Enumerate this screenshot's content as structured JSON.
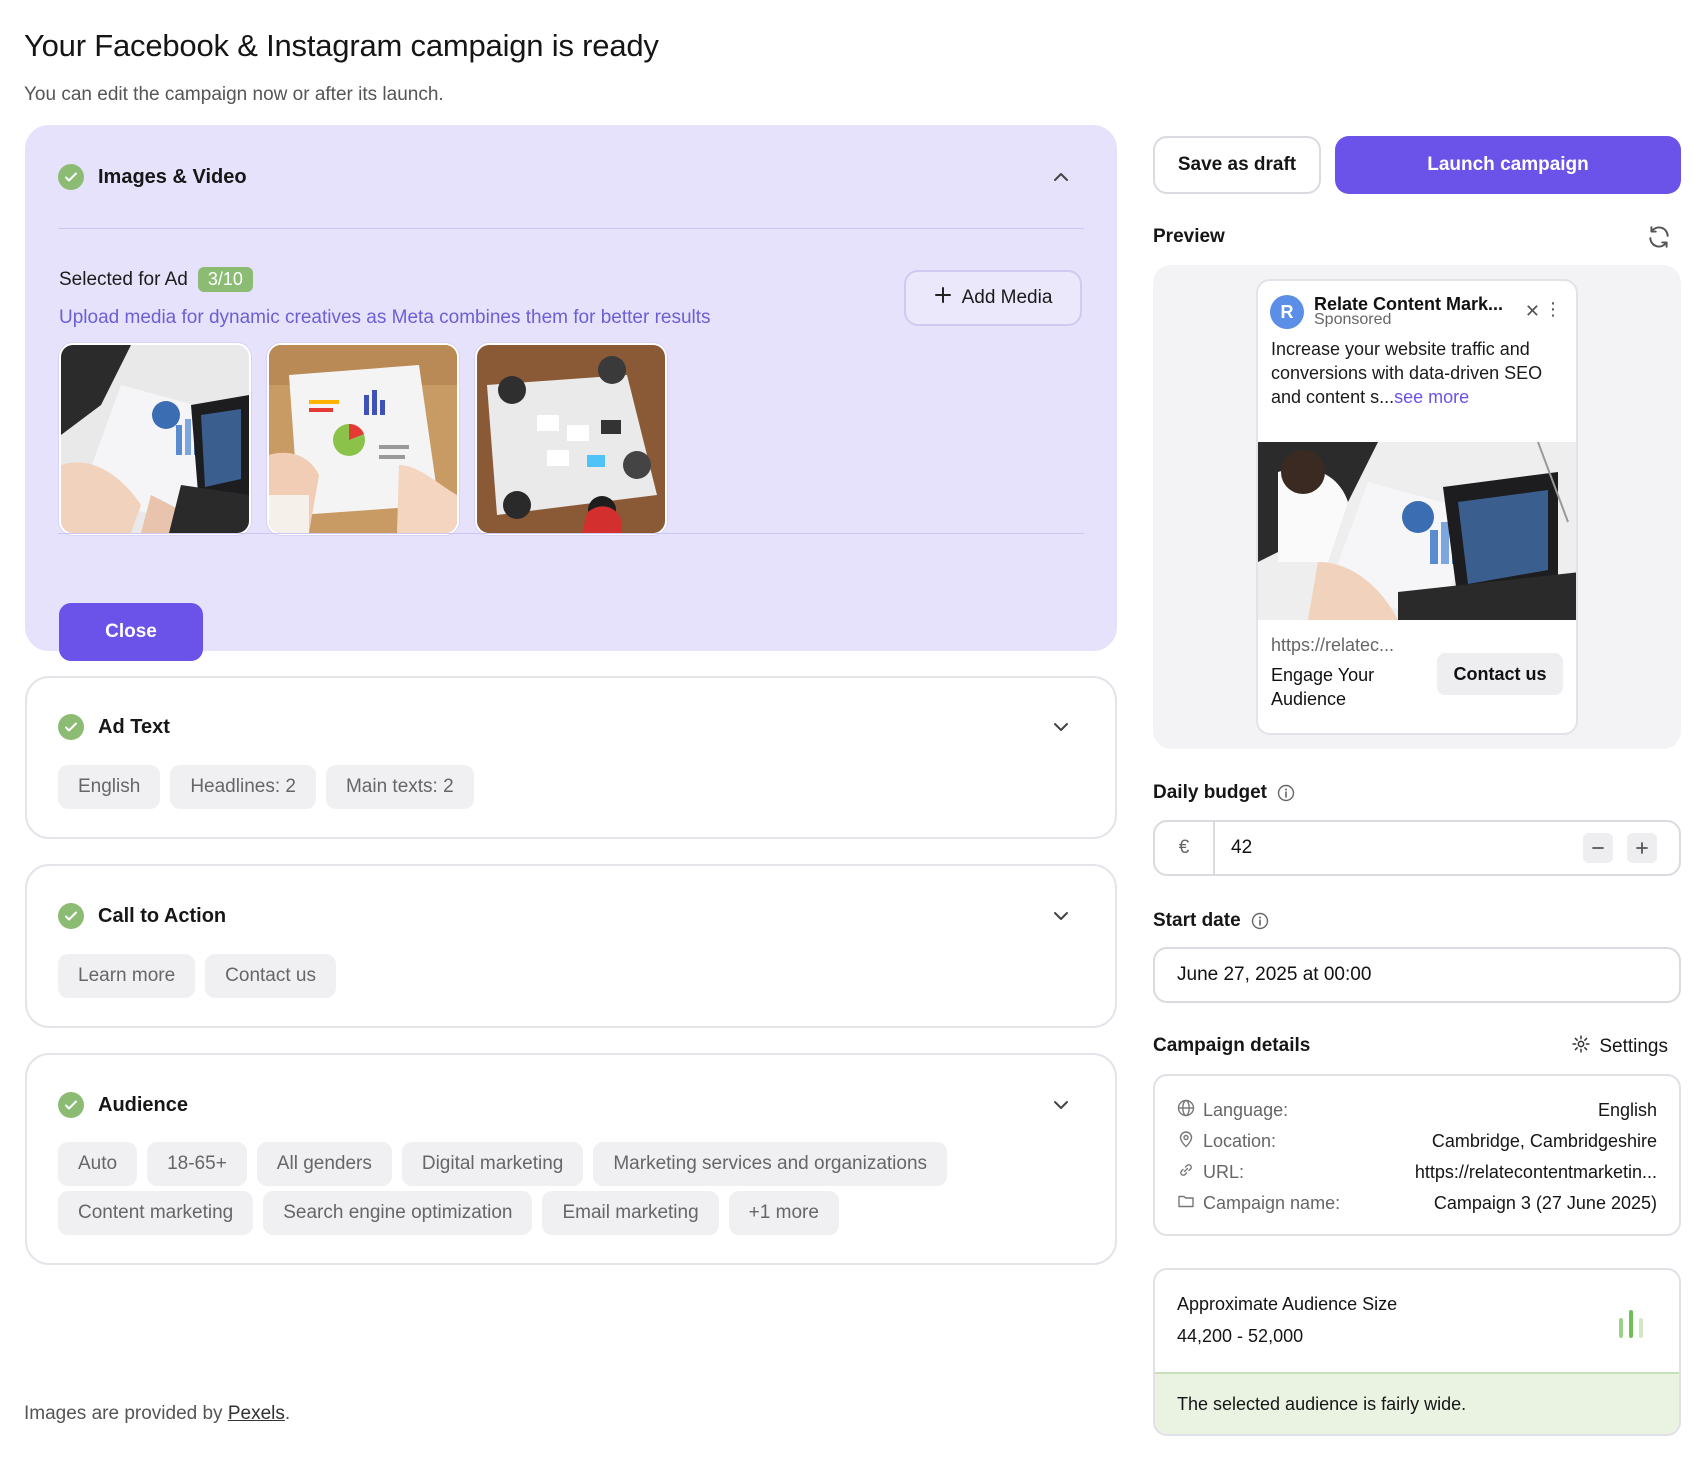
{
  "page": {
    "title": "Your Facebook & Instagram campaign is ready",
    "subtitle": "You can edit the campaign now or after its launch."
  },
  "images_section": {
    "title": "Images & Video",
    "selected_label": "Selected for Ad",
    "selected_count": "3/10",
    "upload_hint": "Upload media for dynamic creatives as Meta combines them for better results",
    "add_media_label": "Add Media",
    "close_label": "Close",
    "thumbnails": [
      "laptop-charts-photo",
      "paper-infographic-photo",
      "team-meeting-overhead-photo"
    ]
  },
  "ad_text_section": {
    "title": "Ad Text",
    "chips": [
      "English",
      "Headlines: 2",
      "Main texts: 2"
    ]
  },
  "cta_section": {
    "title": "Call to Action",
    "chips": [
      "Learn more",
      "Contact us"
    ]
  },
  "audience_section": {
    "title": "Audience",
    "chips": [
      "Auto",
      "18-65+",
      "All genders",
      "Digital marketing",
      "Marketing services and organizations",
      "Content marketing",
      "Search engine optimization",
      "Email marketing",
      "+1 more"
    ]
  },
  "footnote": {
    "prefix": "Images are provided by ",
    "link": "Pexels",
    "suffix": "."
  },
  "actions": {
    "save_draft": "Save as draft",
    "launch": "Launch campaign"
  },
  "preview": {
    "label": "Preview",
    "ad": {
      "avatar_letter": "R",
      "page_name": "Relate Content Mark...",
      "sponsored": "Sponsored",
      "body": "Increase your website traffic and conversions with data-driven SEO and content s...",
      "see_more": "see more",
      "url": "https://relatec...",
      "headline": "Engage Your Audience",
      "cta": "Contact us"
    }
  },
  "budget": {
    "label": "Daily budget",
    "currency": "€",
    "value": "42"
  },
  "start_date": {
    "label": "Start date",
    "value": "June 27, 2025 at 00:00"
  },
  "details": {
    "label": "Campaign details",
    "settings_label": "Settings",
    "rows": [
      {
        "icon": "globe-icon",
        "key": "Language:",
        "value": "English"
      },
      {
        "icon": "location-pin-icon",
        "key": "Location:",
        "value": "Cambridge, Cambridgeshire"
      },
      {
        "icon": "link-icon",
        "key": "URL:",
        "value": "https://relatecontentmarketin..."
      },
      {
        "icon": "folder-icon",
        "key": "Campaign name:",
        "value": "Campaign 3 (27 June 2025)"
      }
    ]
  },
  "audience_size": {
    "title": "Approximate Audience Size",
    "value": "44,200 - 52,000",
    "note": "The selected audience is fairly wide."
  },
  "colors": {
    "accent": "#6b52e8",
    "success": "#8cbc74",
    "panel": "#e6e2fb"
  }
}
